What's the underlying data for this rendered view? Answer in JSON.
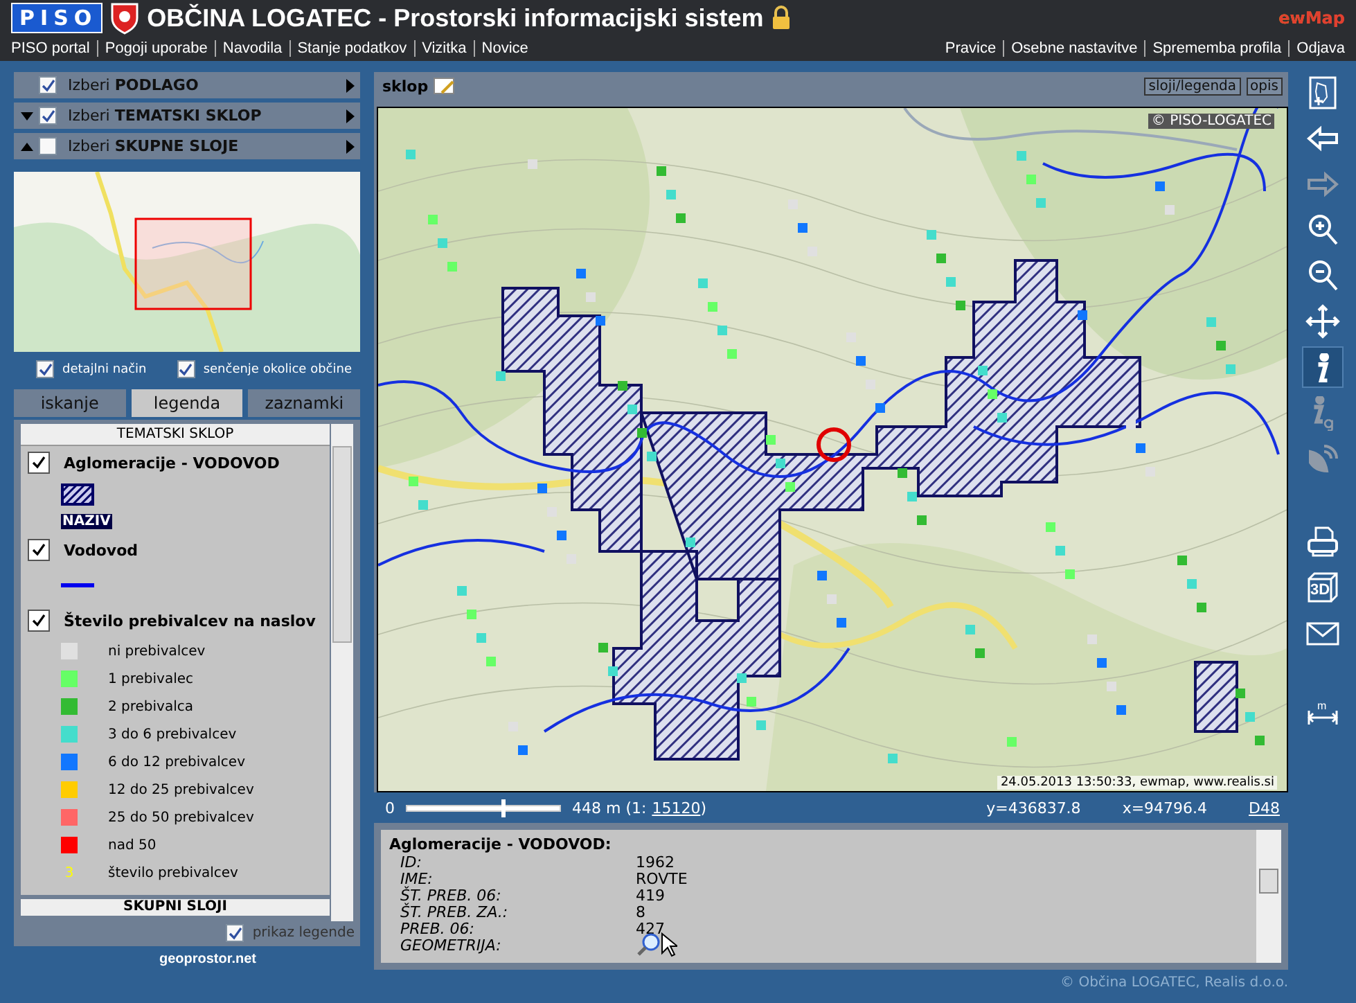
{
  "header": {
    "logo": "PISO",
    "title": "OBČINA LOGATEC - Prostorski informacijski sistem",
    "brand": "ewMap"
  },
  "nav_left": [
    "PISO portal",
    "Pogoji uporabe",
    "Navodila",
    "Stanje podatkov",
    "Vizitka",
    "Novice"
  ],
  "nav_right": [
    "Pravice",
    "Osebne nastavitve",
    "Sprememba profila",
    "Odjava"
  ],
  "sidebar": {
    "panels": [
      {
        "label": "Izberi **PODLAGO**",
        "checked": true,
        "kind": "plain"
      },
      {
        "label": "Izberi **TEMATSKI SKLOP**",
        "checked": true,
        "kind": "toggle",
        "expanded": true
      },
      {
        "label": "Izberi **SKUPNE SLOJE**",
        "checked": false,
        "kind": "toggle",
        "expanded": false
      }
    ],
    "options": [
      {
        "label": "detajlni način",
        "checked": true
      },
      {
        "label": "senčenje okolice občine",
        "checked": true
      }
    ],
    "tabs": [
      {
        "label": "iskanje",
        "selected": false
      },
      {
        "label": "legenda",
        "selected": true
      },
      {
        "label": "zaznamki",
        "selected": false
      }
    ],
    "legend": {
      "title": "TEMATSKI SKLOP",
      "groups": [
        {
          "label": "Aglomeracije - VODOVOD",
          "checked": true,
          "items": [
            {
              "kind": "hatch"
            },
            {
              "kind": "tag",
              "text": "NAZIV"
            }
          ]
        },
        {
          "label": "Vodovod",
          "checked": true,
          "items": [
            {
              "kind": "line"
            }
          ]
        },
        {
          "label": "Število prebivalcev na naslov",
          "checked": true,
          "items": [
            {
              "kind": "swatch",
              "color": "#e0e0e0",
              "text": "ni prebivalcev"
            },
            {
              "kind": "swatch",
              "color": "#66ff66",
              "text": "1 prebivalec"
            },
            {
              "kind": "swatch",
              "color": "#33bb33",
              "text": "2 prebivalca"
            },
            {
              "kind": "swatch",
              "color": "#44ddcc",
              "text": "3 do 6 prebivalcev"
            },
            {
              "kind": "swatch",
              "color": "#1177ff",
              "text": "6 do 12 prebivalcev"
            },
            {
              "kind": "swatch",
              "color": "#ffcc00",
              "text": "12 do 25 prebivalcev"
            },
            {
              "kind": "swatch",
              "color": "#ff6666",
              "text": "25 do 50 prebivalcev"
            },
            {
              "kind": "swatch",
              "color": "#ff0000",
              "text": "nad 50"
            },
            {
              "kind": "number",
              "symbol": "3",
              "text": "število prebivalcev"
            }
          ]
        }
      ],
      "next_section": "SKUPNI SLOJI"
    },
    "show_legend": {
      "label": "prikaz legende",
      "checked": true
    },
    "footer_logo": "geoprostor.net"
  },
  "map": {
    "title": "sklop",
    "buttons": [
      "sloji/legenda",
      "opis"
    ],
    "copyright": "© PISO-LOGATEC",
    "timestamp": "24.05.2013 13:50:33, ewmap, www.realis.si"
  },
  "scale": {
    "start": "0",
    "level": 0.62,
    "distance": "448 m (1:",
    "ratio": "15120",
    "close": ")",
    "y": "y=436837.8",
    "x": "x=94796.4",
    "datum": "D48"
  },
  "info": {
    "title": "Aglomeracije - VODOVOD:",
    "rows": [
      {
        "label": "ID:",
        "value": "1962"
      },
      {
        "label": "IME:",
        "value": "ROVTE"
      },
      {
        "label": "ŠT. PREB. 06:",
        "value": "419"
      },
      {
        "label": "ŠT. PREB. ZA.:",
        "value": "8"
      },
      {
        "label": "PREB. 06:",
        "value": "427"
      },
      {
        "label": "GEOMETRIJA:",
        "kind": "zoom"
      }
    ]
  },
  "toolbar": [
    {
      "kind": "overview",
      "selected": false,
      "disabled": false
    },
    {
      "kind": "back",
      "selected": false,
      "disabled": false
    },
    {
      "kind": "forward",
      "selected": false,
      "disabled": true
    },
    {
      "kind": "zoom-in",
      "selected": false,
      "disabled": false
    },
    {
      "kind": "zoom-out",
      "selected": false,
      "disabled": false
    },
    {
      "kind": "pan",
      "selected": false,
      "disabled": false
    },
    {
      "kind": "info",
      "selected": true,
      "disabled": false
    },
    {
      "kind": "info-g",
      "selected": false,
      "disabled": true
    },
    {
      "kind": "satellite",
      "selected": false,
      "disabled": true
    },
    {
      "kind": "gap"
    },
    {
      "kind": "print",
      "selected": false,
      "disabled": false
    },
    {
      "kind": "cube",
      "label": "3D",
      "selected": false,
      "disabled": false
    },
    {
      "kind": "mail",
      "selected": false,
      "disabled": false
    },
    {
      "kind": "gap"
    },
    {
      "kind": "measure",
      "label": "m",
      "selected": false,
      "disabled": false
    }
  ],
  "copyright": "© Občina LOGATEC, Realis d.o.o."
}
